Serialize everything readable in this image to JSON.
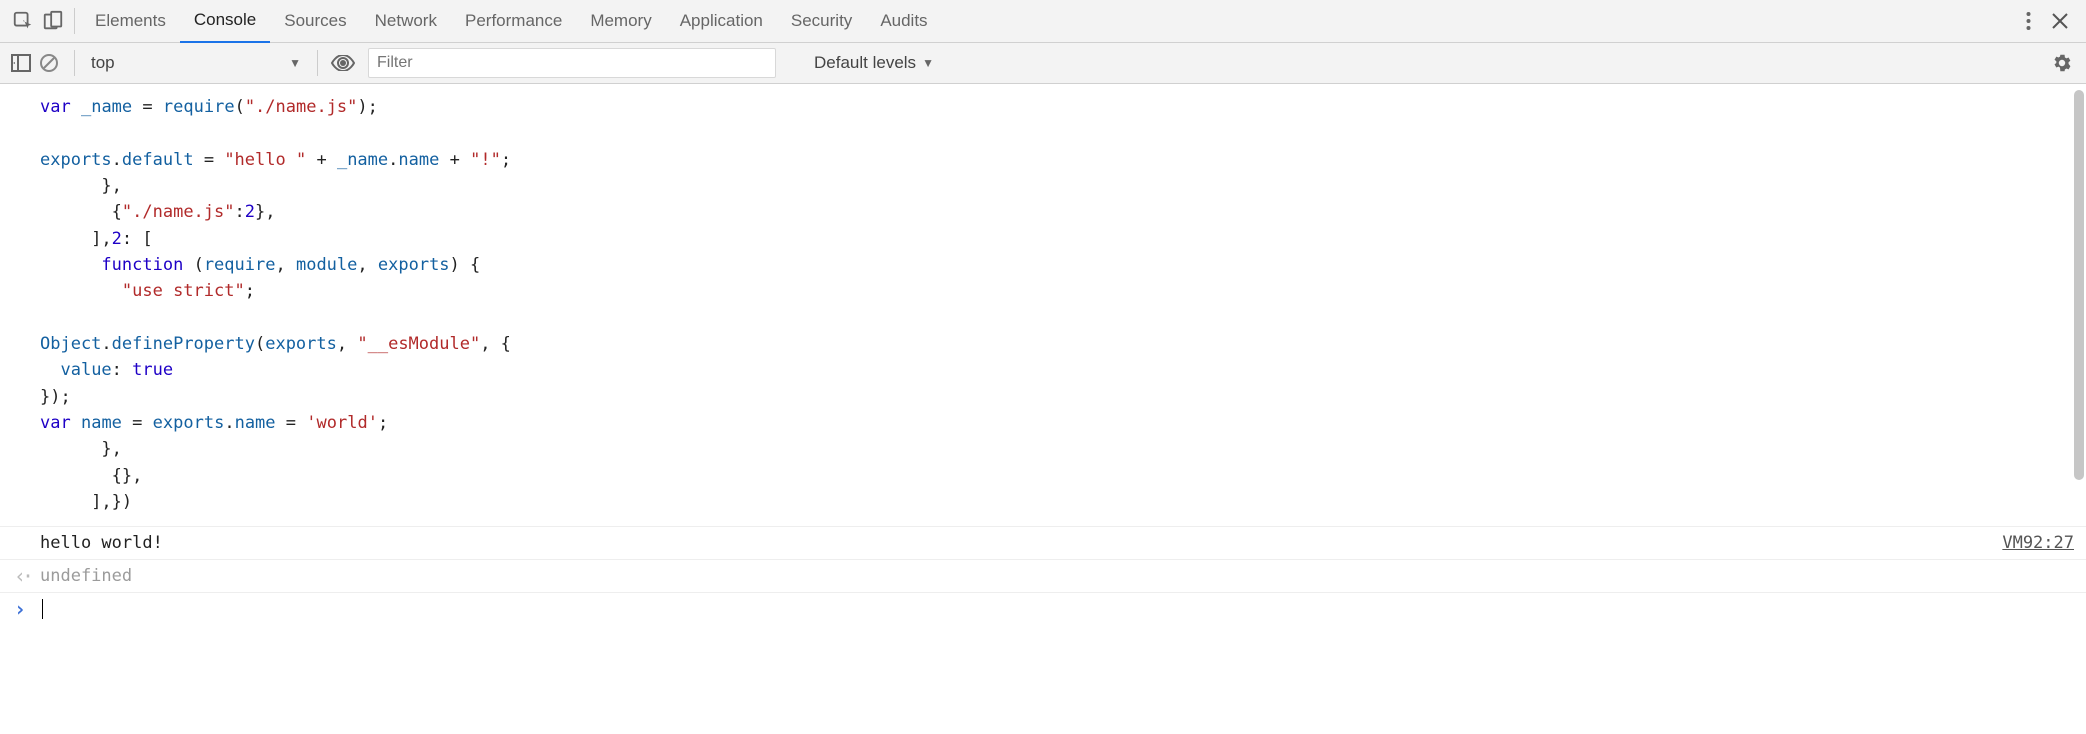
{
  "tabs": [
    "Elements",
    "Console",
    "Sources",
    "Network",
    "Performance",
    "Memory",
    "Application",
    "Security",
    "Audits"
  ],
  "active_tab": "Console",
  "toolbar": {
    "context": "top",
    "filter_placeholder": "Filter",
    "levels": "Default levels"
  },
  "console": {
    "code_lines": [
      "var _name = require(\"./name.js\");",
      "",
      "exports.default = \"hello \" + _name.name + \"!\";",
      "      },",
      "       {\"./name.js\":2},",
      "     ],2: [",
      "      function (require, module, exports) {",
      "        \"use strict\";",
      "",
      "Object.defineProperty(exports, \"__esModule\", {",
      "  value: true",
      "});",
      "var name = exports.name = 'world';",
      "      },",
      "       {},",
      "     ],})"
    ],
    "log_output": "hello world!",
    "source_link": "VM92:27",
    "result": "undefined"
  }
}
